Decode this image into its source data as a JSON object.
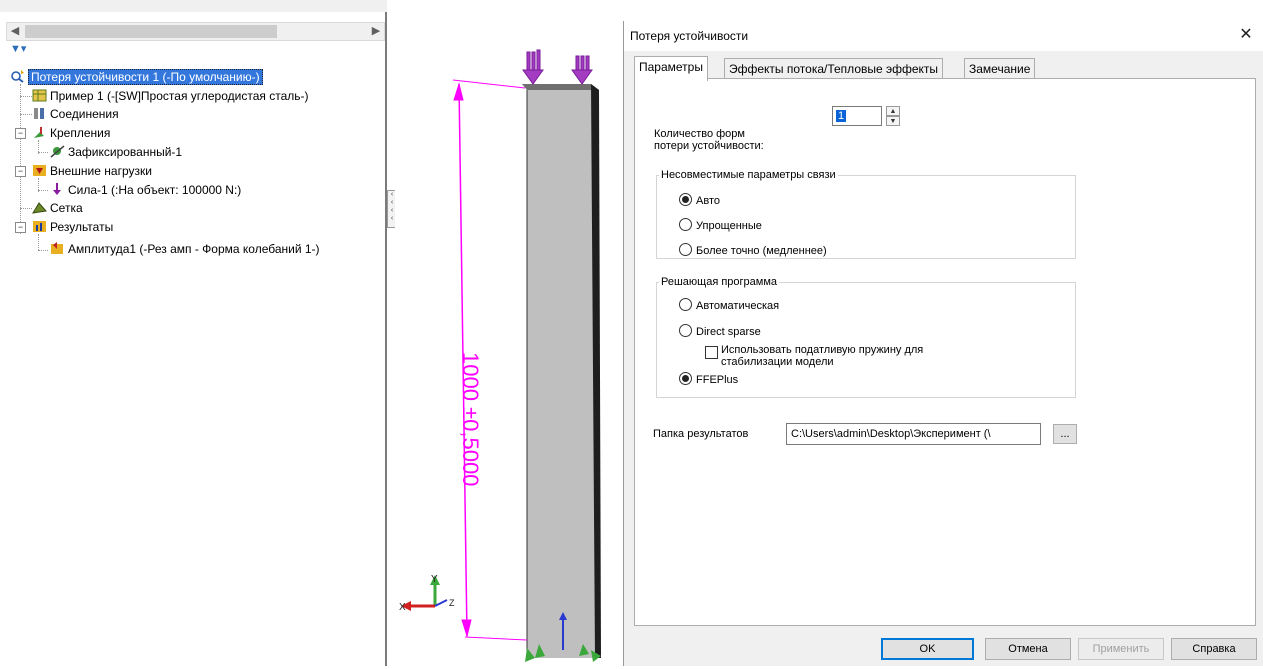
{
  "tree": {
    "items": [
      {
        "label": "Потеря устойчивости 1 (-По умолчанию-)",
        "icon": "study-icon",
        "selected": true
      },
      {
        "label": "Пример 1 (-[SW]Простая углеродистая сталь-)",
        "icon": "part-icon"
      },
      {
        "label": "Соединения",
        "icon": "connections-icon"
      },
      {
        "label": "Крепления",
        "icon": "fixtures-icon"
      },
      {
        "label": "Зафиксированный-1",
        "icon": "fixed-icon"
      },
      {
        "label": "Внешние нагрузки",
        "icon": "loads-icon"
      },
      {
        "label": "Сила-1 (:На объект: 100000 N:)",
        "icon": "force-icon"
      },
      {
        "label": "Сетка",
        "icon": "mesh-icon"
      },
      {
        "label": "Результаты",
        "icon": "results-icon"
      },
      {
        "label": "Амплитуда1 (-Рез амп - Форма колебаний 1-)",
        "icon": "amplitude-plot-icon"
      }
    ],
    "filter_icon": "filter-icon",
    "accent_color": "#3377dd"
  },
  "viewport": {
    "dimension_text": "1000 ±0,5000",
    "dimension_color": "#ff00ff",
    "axis_x": "X",
    "axis_y": "Y",
    "axis_z": "Z"
  },
  "dialog": {
    "title": "Потеря устойчивости",
    "close_icon": "close-icon",
    "tabs": [
      {
        "label": "Параметры",
        "active": true
      },
      {
        "label": "Эффекты потока/Тепловые эффекты",
        "active": false
      },
      {
        "label": "Замечание",
        "active": false
      }
    ],
    "modes": {
      "label_line1": "Количество форм",
      "label_line2": "потери устойчивости:",
      "value": "1"
    },
    "incompatible_group": {
      "legend": "Несовместимые параметры связи",
      "options": [
        {
          "label": "Авто",
          "checked": true
        },
        {
          "label": "Упрощенные",
          "checked": false
        },
        {
          "label": "Более точно (медленнее)",
          "checked": false
        }
      ]
    },
    "solver_group": {
      "legend": "Решающая программа",
      "options": [
        {
          "label": "Автоматическая",
          "checked": false
        },
        {
          "label": "Direct sparse",
          "checked": false
        },
        {
          "label": "FFEPlus",
          "checked": true
        }
      ],
      "soft_spring": {
        "line1": "Использовать податливую пружину для",
        "line2": "стабилизации модели",
        "checked": false
      }
    },
    "results_folder": {
      "label": "Папка результатов",
      "value": "C:\\Users\\admin\\Desktop\\Эксперимент (\\",
      "browse": "..."
    },
    "buttons": {
      "ok": "OK",
      "cancel": "Отмена",
      "apply": "Применить",
      "help": "Справка"
    }
  }
}
